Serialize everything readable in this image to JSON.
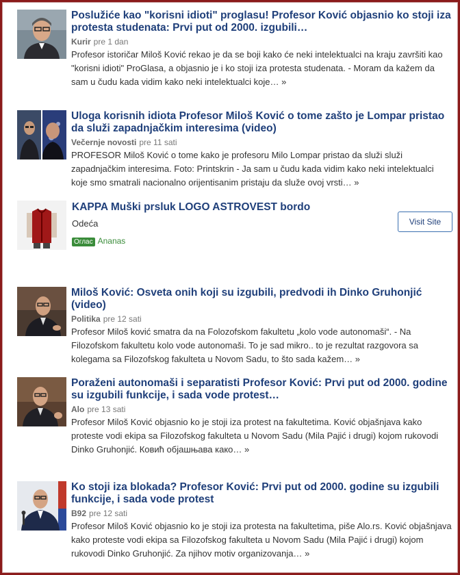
{
  "articles": [
    {
      "title": "Poslužiće kao \"korisni idioti\" proglasu! Profesor Ković objasnio ko stoji iza protesta studenata: Prvi put od 2000. izgubili…",
      "source": "Kurir",
      "time": "pre 1 dan",
      "summary": "Profesor istoričar Miloš Ković rekao je da se boji kako će neki intelektualci na kraju završiti kao \"korisni idioti\" ProGlasa, a objasnio je i ko stoji iza protesta studenata. - Moram da kažem da sam u čudu kada vidim kako neki intelektualci koje…",
      "more": "»"
    },
    {
      "title": "Uloga korisnih idiota Profesor Miloš Ković o tome zašto je Lompar pristao da služi zapadnjačkim interesima (video)",
      "source": "Večernje novosti",
      "time": "pre 11 sati",
      "summary": "PROFESOR Miloš Ković o tome kako je profesoru Milo Lompar pristao da služi služi zapadnjačkim interesima. Foto: Printskrin - Ja sam u čudu kada vidim kako neki intelektualci koje smo smatrali nacionalno orijentisanim pristaju da služe ovoj vrsti…",
      "more": "»"
    },
    {
      "title": "Miloš Ković: Osveta onih koji su izgubili, predvodi ih Dinko Gruhonjić (video)",
      "source": "Politika",
      "time": "pre 12 sati",
      "summary": "Profesor Miloš ković smatra da na Folozofskom fakultetu „kolo vode autonomaši“. - Na Filozofskom fakultetu kolo vode autonomaši. To je sad mikro.. to je rezultat razgovora sa kolegama sa Filozofskog fakulteta u Novom Sadu, to što sada kažem…",
      "more": "»"
    },
    {
      "title": "Poraženi autonomaši i separatisti Profesor Ković: Prvi put od 2000. godine su izgubili funkcije, i sada vode protest…",
      "source": "Alo",
      "time": "pre 13 sati",
      "summary": "Profesor Miloš Ković objasnio ko je stoji iza protest na fakultetima. Ković objašnjava kako proteste vodi ekipa sa Filozofskog fakulteta u Novom Sadu (Mila Pajić i drugi) kojom rukovodi Dinko Gruhonjić. Ковић објашњава како…",
      "more": "»"
    },
    {
      "title": "Ko stoji iza blokada? Profesor Ković: Prvi put od 2000. godine su izgubili funkcije, i sada vode protest",
      "source": "B92",
      "time": "pre 12 sati",
      "summary": "Profesor Miloš Ković objasnio ko je stoji iza protesta na fakultetima, piše Alo.rs. Ković objašnjava kako proteste vodi ekipa sa Filozofskog fakulteta u Novom Sadu (Mila Pajić i drugi) kojom rukovodi Dinko Gruhonjić. Za njihov motiv organizovanja…",
      "more": "»"
    }
  ],
  "ad": {
    "title": "KAPPA Muški prsluk LOGO ASTROVEST bordo",
    "category": "Odeća",
    "badge": "Оглас",
    "brand": "Ananas",
    "button": "Visit Site"
  },
  "colors": {
    "title": "#1f3f7a",
    "frame": "#8b1a1a",
    "ad_green": "#3a8c3a"
  }
}
